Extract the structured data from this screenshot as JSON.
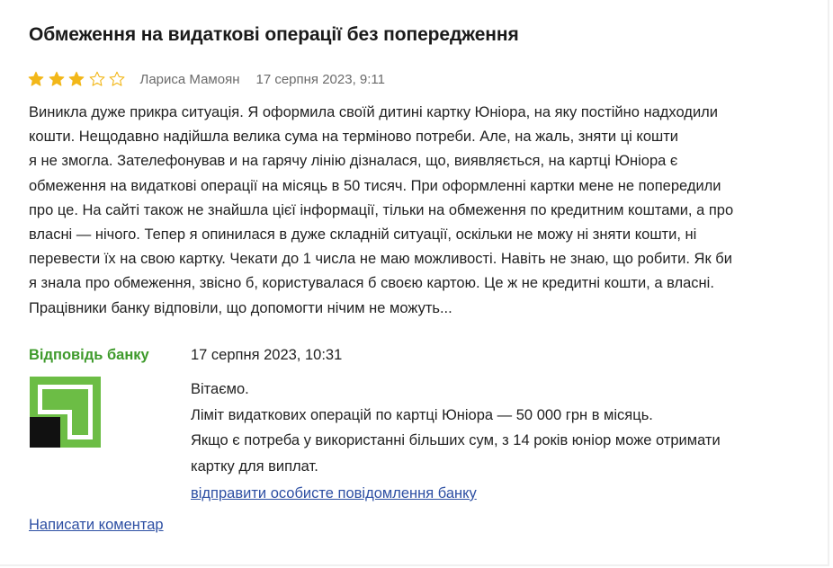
{
  "review": {
    "title": "Обмеження на видаткові операції без попередження",
    "rating": 3,
    "rating_max": 5,
    "star_color": "#f2b719",
    "star_empty_color": "#f2b719",
    "author": "Лариса Мамоян",
    "date": "17 серпня 2023, 9:11",
    "text_lines": [
      "Виникла дуже прикра ситуація. Я оформила своїй дитині картку Юніора, на яку постійно надходили",
      "кошти. Нещодавно надійшла велика сума на терміново потреби. Але, на жаль, зняти ці кошти",
      "я не змогла. Зателефонував и на гарячу лінію дізналася, що, виявляється, на картці Юніора є",
      "обмеження на видаткові операції на місяць в 50 тисяч. При оформленні картки мене не попередили",
      "про це. На сайті також не знайшла цієї інформації, тільки на обмеження по кредитним коштами, а про",
      "власні — нічого. Тепер я опинилася в дуже складній ситуації, оскільки не можу ні зняти кошти, ні",
      "перевести їх на свою картку. Чекати до 1 числа не маю можливості. Навіть не знаю, що робити. Як би",
      "я знала про обмеження, звісно б, користувалася б своєю картою. Це ж не кредитні кошти, а власні.",
      "Працівники банку відповіли, що допомогти нічим не можуть..."
    ]
  },
  "answer": {
    "label": "Відповідь банку",
    "label_color": "#3e9a2b",
    "date": "17 серпня 2023, 10:31",
    "logo_name": "privatbank-logo",
    "logo_color": "#6cbd45",
    "text_lines": [
      "Вітаємо.",
      "Ліміт видаткових операцій по картці Юніора — 50 000 грн в місяць.",
      "Якщо є потреба у використанні більших сум, з 14 років юніор може отримати",
      "картку для виплат."
    ],
    "private_message_link": "відправити особисте повідомлення банку"
  },
  "actions": {
    "write_comment_link": "Написати коментар",
    "link_color": "#2d4fa3"
  }
}
